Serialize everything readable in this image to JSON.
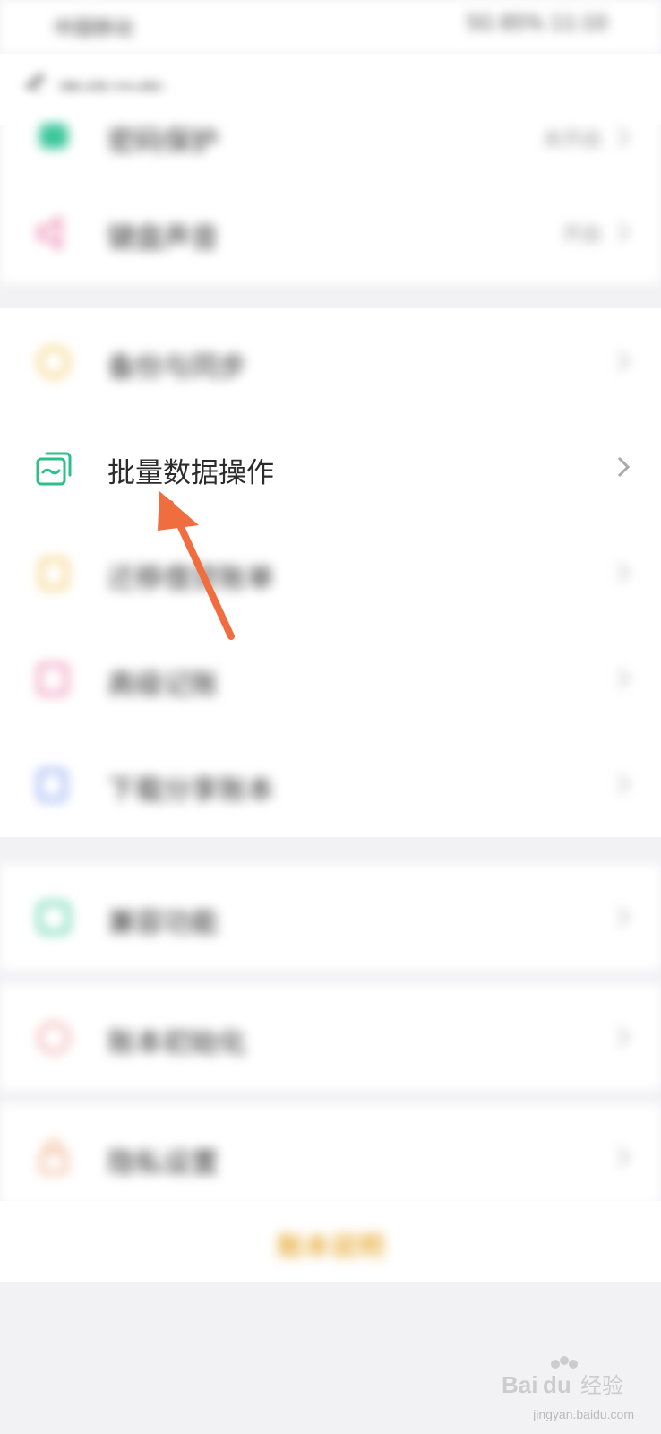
{
  "status_bar": {
    "left": "中国移动",
    "right": "5G 85% 11:10"
  },
  "header": {
    "title": "高级功能"
  },
  "groups": [
    {
      "items": [
        {
          "label": "密码保护",
          "value": "未开启",
          "icon": "shield-icon",
          "color": "#3cc79a"
        },
        {
          "label": "键盘声音",
          "value": "开启",
          "icon": "speaker-icon",
          "color": "#e97fa6"
        }
      ]
    },
    {
      "items": [
        {
          "label": "备份与同步",
          "icon": "sync-icon",
          "color": "#f2c55a"
        },
        {
          "label": "批量数据操作",
          "icon": "batch-data-icon",
          "color": "#2dbf8a"
        },
        {
          "label": "迁移借贷账单",
          "icon": "transfer-icon",
          "color": "#f2c55a"
        },
        {
          "label": "高级记账",
          "icon": "advanced-note-icon",
          "color": "#e97fa6"
        },
        {
          "label": "下载分享账本",
          "icon": "download-share-icon",
          "color": "#7f9cf0"
        }
      ]
    },
    {
      "items": [
        {
          "label": "兼容功能",
          "icon": "compat-icon",
          "color": "#3cc79a"
        }
      ]
    },
    {
      "items": [
        {
          "label": "账本初始化",
          "icon": "reset-icon",
          "color": "#f0a3a3"
        }
      ]
    },
    {
      "items": [
        {
          "label": "隐私设置",
          "icon": "privacy-lock-icon",
          "color": "#f0b490"
        }
      ]
    }
  ],
  "footer": {
    "link": "账本说明"
  },
  "watermark": {
    "text": "jingyan.baidu.com",
    "logo": "Baidu经验"
  },
  "colors": {
    "accent": "#2dbf8a",
    "arrow": "#f06d3f",
    "footer_link": "#e8b34a"
  }
}
